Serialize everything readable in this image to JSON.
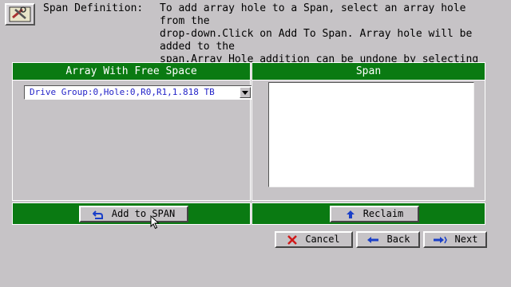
{
  "header": {
    "icon": "wrench-tools-icon",
    "title": "Span Definition:",
    "instructions": "To add array hole to a Span, select an array hole from the\ndrop-down.Click on Add To Span. Array hole will be added to the\nspan.Array Hole addition can be undone by selecting the\nReclaim button."
  },
  "left_panel": {
    "title": "Array With Free Space",
    "dropdown_value": "Drive Group:0,Hole:0,R0,R1,1.818 TB",
    "add_button_label": "Add to SPAN"
  },
  "right_panel": {
    "title": "Span",
    "reclaim_button_label": "Reclaim"
  },
  "footer": {
    "cancel_label": "Cancel",
    "back_label": "Back",
    "next_label": "Next"
  },
  "colors": {
    "background": "#c6c3c6",
    "accent_green": "#0a7a12",
    "dropdown_text": "#2323c8"
  }
}
